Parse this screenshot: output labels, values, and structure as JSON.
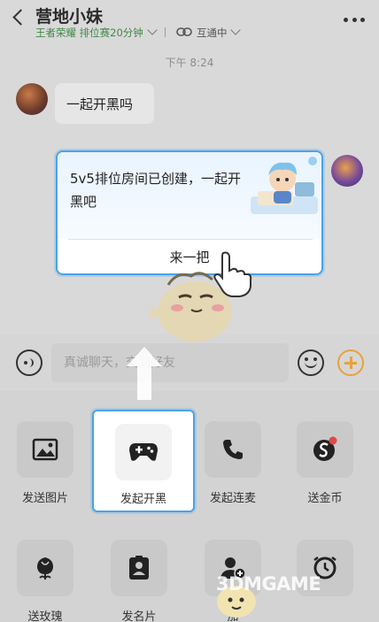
{
  "header": {
    "title": "营地小妹",
    "subtitle": "王者荣耀 排位赛20分钟",
    "link_status": "互通中"
  },
  "chat": {
    "timestamp": "下午 8:24",
    "message_left": "一起开黑吗",
    "card": {
      "text": "5v5排位房间已创建，一起开黑吧",
      "button_label": "来一把"
    }
  },
  "input": {
    "placeholder": "真诚聊天，交到好友"
  },
  "tools": [
    {
      "label": "发送图片",
      "icon": "image-icon"
    },
    {
      "label": "发起开黑",
      "icon": "gamepad-icon"
    },
    {
      "label": "发起连麦",
      "icon": "phone-icon"
    },
    {
      "label": "送金币",
      "icon": "coin-icon"
    },
    {
      "label": "送玫瑰",
      "icon": "rose-icon"
    },
    {
      "label": "发名片",
      "icon": "card-icon"
    },
    {
      "label": "加",
      "icon": "add-friend-icon"
    },
    {
      "label": "",
      "icon": "timer-icon"
    }
  ],
  "watermark": {
    "text": "3DMGAME"
  },
  "colors": {
    "accent_blue": "#4aa3e8",
    "accent_orange": "#e7a23a",
    "subtitle_green": "#3f8a46"
  }
}
